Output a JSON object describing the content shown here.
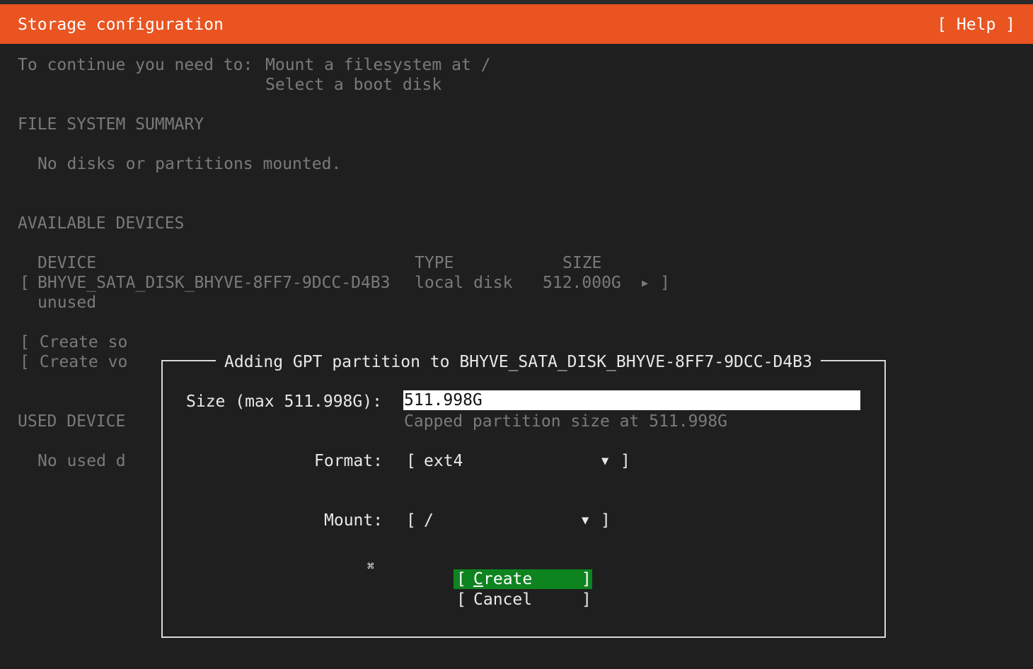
{
  "header": {
    "title": "Storage configuration",
    "help": "[ Help ]"
  },
  "notice": {
    "prefix": "To continue you need to:",
    "line1": "Mount a filesystem at /",
    "line2": "Select a boot disk"
  },
  "fs_summary": {
    "heading": "FILE SYSTEM SUMMARY",
    "empty": "No disks or partitions mounted."
  },
  "available": {
    "heading": "AVAILABLE DEVICES",
    "columns": {
      "device": "DEVICE",
      "type": "TYPE",
      "size": "SIZE"
    },
    "device": {
      "open": "[",
      "name": "BHYVE_SATA_DISK_BHYVE-8FF7-9DCC-D4B3",
      "type": "local disk",
      "size": "512.000G",
      "arrow": "▶",
      "close": "]",
      "status": "unused"
    },
    "actions": [
      "[ Create so",
      "[ Create vo"
    ]
  },
  "used": {
    "heading": "USED DEVICE",
    "empty": "No used d"
  },
  "dialog": {
    "title": "Adding GPT partition to BHYVE_SATA_DISK_BHYVE-8FF7-9DCC-D4B3",
    "size_label": "Size (max 511.998G):",
    "size_value": "511.998G",
    "size_hint": "Capped partition size at 511.998G",
    "format_label": "Format:",
    "format_open": "[",
    "format_value": "ext4",
    "format_arrow": "▼",
    "format_close": "]",
    "mount_label": "Mount:",
    "mount_open": "[",
    "mount_value": "/",
    "mount_arrow": "▼",
    "mount_close": "]",
    "cursor_glyph": "⌘",
    "create_button": {
      "open": "[",
      "first": "C",
      "rest": "reate",
      "close": "]"
    },
    "cancel_button": {
      "open": "[",
      "label": "Cancel",
      "close": "]"
    }
  },
  "colors": {
    "header_bg": "#e95420",
    "focus_button_bg": "#0e8420",
    "background": "#1f1f1f"
  }
}
